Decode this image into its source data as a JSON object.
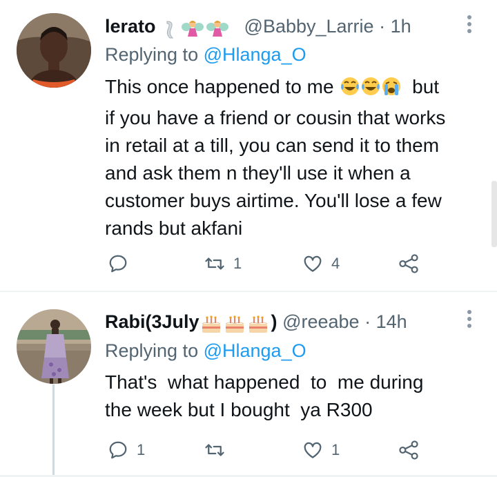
{
  "tweets": [
    {
      "name": "lerato",
      "name_emojis": [
        "ribbon-emoji",
        "fairy-emoji",
        "fairy-emoji"
      ],
      "handle": "@Babby_Larrie",
      "dot": "·",
      "time": "1h",
      "replying_prefix": "Replying to ",
      "replying_to": "@Hlanga_O",
      "text_lines": [
        "This once happened to me",
        "if you have a friend or cousin that works",
        "in retail at a till, you can send it to them",
        "and ask them n they'll use it when a",
        "customer buys airtime. You'll lose a few",
        "rands but akfani"
      ],
      "text_line1_suffix": "but",
      "inline_emojis": [
        "laughing-tears-emoji",
        "laughing-tears-emoji",
        "crying-emoji"
      ],
      "actions": {
        "replies": "",
        "retweets": "1",
        "likes": "4"
      }
    },
    {
      "name": "Rabi(3July",
      "name_suffix": ")",
      "name_emojis": [
        "birthday-cake-emoji",
        "birthday-cake-emoji",
        "birthday-cake-emoji"
      ],
      "handle": "@reeabe",
      "dot": "·",
      "time": "14h",
      "replying_prefix": "Replying to ",
      "replying_to": "@Hlanga_O",
      "text_lines": [
        "That's  what happened  to  me during",
        "the week but I bought  ya R300"
      ],
      "actions": {
        "replies": "1",
        "retweets": "",
        "likes": "1"
      }
    }
  ],
  "colors": {
    "text": "#0f1419",
    "secondary": "#536471",
    "link": "#1d9bf0",
    "divider": "#eff3f4",
    "thread_line": "#cfd9de"
  }
}
